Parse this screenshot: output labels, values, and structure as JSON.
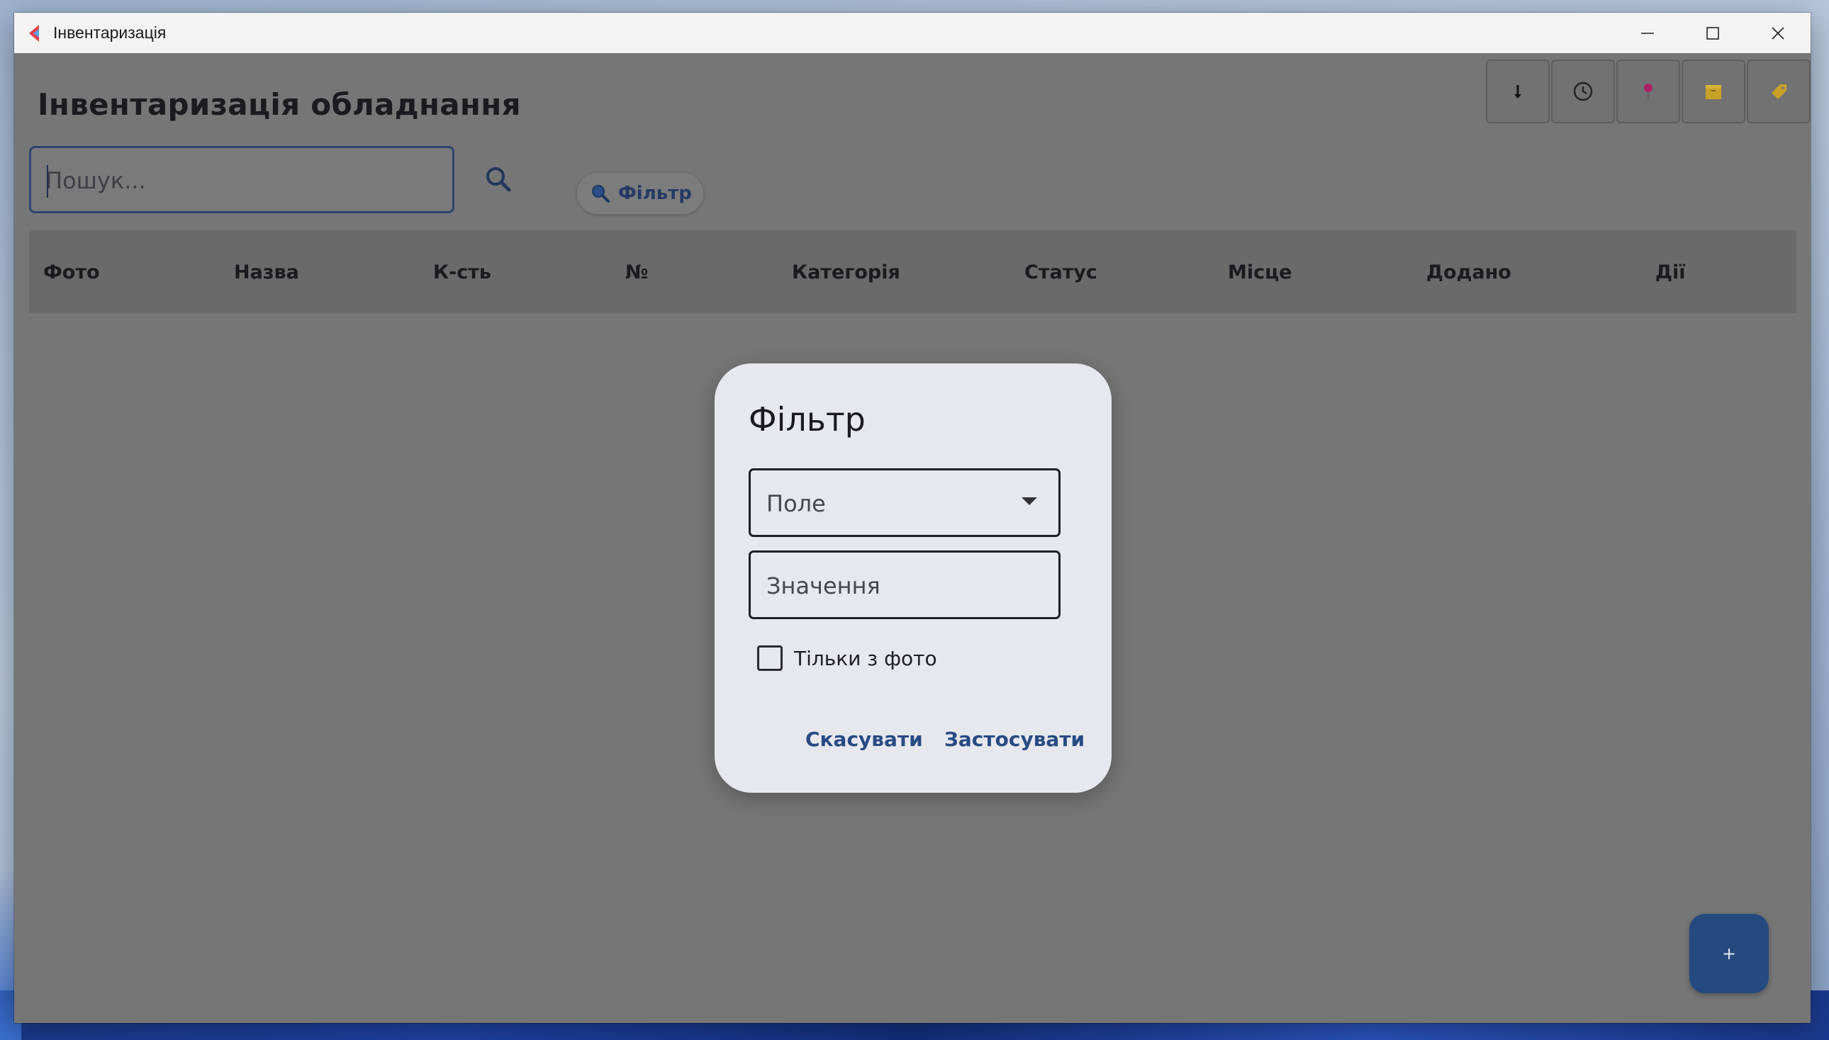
{
  "window": {
    "title": "Інвентаризація",
    "controls": [
      "minimize",
      "maximize",
      "close"
    ]
  },
  "app": {
    "heading": "Інвентаризація обладнання",
    "toolbar": [
      {
        "name": "sort-icon",
        "glyph": "↓"
      },
      {
        "name": "history-icon",
        "glyph": "clock"
      },
      {
        "name": "pin-icon",
        "glyph": "pin",
        "color": "#d0287a"
      },
      {
        "name": "box-icon",
        "glyph": "box",
        "color": "#e2b22c"
      },
      {
        "name": "tag-icon",
        "glyph": "tag",
        "color": "#e2b22c"
      }
    ],
    "search": {
      "placeholder": "Пошук...",
      "value": ""
    },
    "filter_chip": "Фільтр",
    "table": {
      "columns": [
        "Фото",
        "Назва",
        "К-сть",
        "№",
        "Категорія",
        "Статус",
        "Місце",
        "Додано",
        "Дії"
      ],
      "rows": []
    },
    "fab_label": "+"
  },
  "dialog": {
    "title": "Фільтр",
    "field_dropdown": {
      "placeholder": "Поле",
      "value": ""
    },
    "value_input": {
      "placeholder": "Значення",
      "value": ""
    },
    "checkbox": {
      "label": "Тільки з фото",
      "checked": false
    },
    "cancel_label": "Скасувати",
    "apply_label": "Застосувати"
  },
  "colors": {
    "accent": "#274b84",
    "overlay": "#767676",
    "dialog_bg": "#e7e8ee",
    "fab": "#254a80"
  }
}
